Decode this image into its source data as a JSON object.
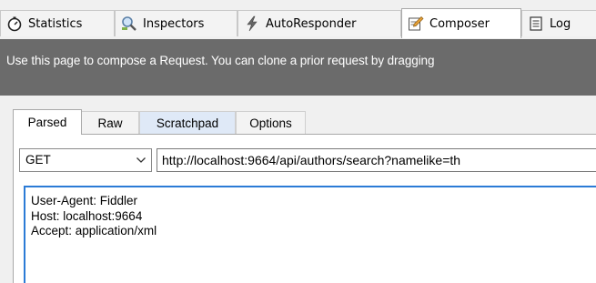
{
  "tabs": [
    {
      "label": "Statistics",
      "icon": "stopwatch-icon"
    },
    {
      "label": "Inspectors",
      "icon": "magnifier-icon"
    },
    {
      "label": "AutoResponder",
      "icon": "lightning-icon"
    },
    {
      "label": "Composer",
      "icon": "pencil-icon",
      "active": true
    },
    {
      "label": "Log",
      "icon": "log-icon"
    }
  ],
  "banner": {
    "text": "Use this page to compose a Request. You can clone a prior request by dragging"
  },
  "subtabs": [
    {
      "label": "Parsed",
      "active": true
    },
    {
      "label": "Raw"
    },
    {
      "label": "Scratchpad"
    },
    {
      "label": "Options"
    }
  ],
  "request": {
    "method": "GET",
    "url": "http://localhost:9664/api/authors/search?namelike=th",
    "headers": [
      "User-Agent: Fiddler",
      "Host: localhost:9664",
      "Accept: application/xml"
    ]
  },
  "colors": {
    "banner_bg": "#6b6b6b",
    "focus_border": "#2b7bd6",
    "scratchpad_tab_bg": "#dfe9f7"
  }
}
